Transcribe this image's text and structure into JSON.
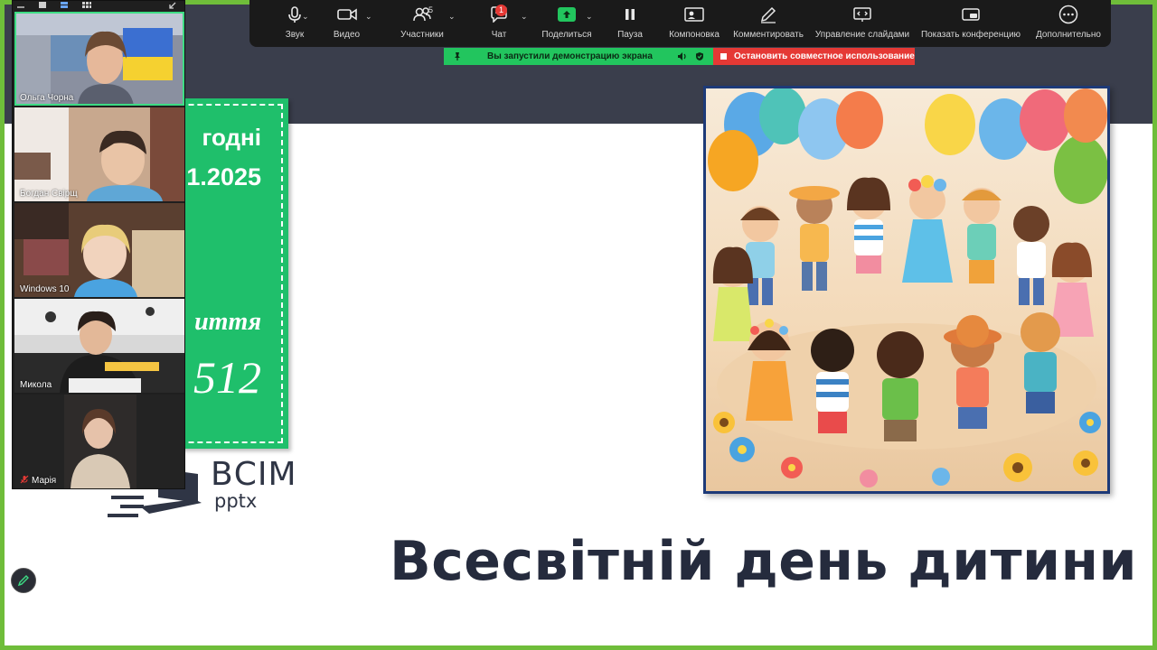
{
  "toolbar": {
    "items": [
      {
        "label": "Звук",
        "icon": "microphone-icon"
      },
      {
        "label": "Видео",
        "icon": "video-camera-icon"
      },
      {
        "label": "Участники",
        "icon": "participants-icon",
        "count": "5"
      },
      {
        "label": "Чат",
        "icon": "chat-icon",
        "badge": "1"
      },
      {
        "label": "Поделиться",
        "icon": "share-screen-icon"
      },
      {
        "label": "Пауза",
        "icon": "pause-icon"
      },
      {
        "label": "Компоновка",
        "icon": "layout-icon"
      },
      {
        "label": "Комментировать",
        "icon": "annotate-pen-icon"
      },
      {
        "label": "Управление слайдами",
        "icon": "slide-control-icon"
      },
      {
        "label": "Показать конференцию",
        "icon": "show-meeting-icon"
      },
      {
        "label": "Дополнительно",
        "icon": "more-icon"
      }
    ]
  },
  "share_notice": {
    "status": "Вы запустили демонстрацию экрана",
    "stop": "Остановить совместное использование"
  },
  "participants": [
    {
      "name": "Ольга Чорна",
      "active": true
    },
    {
      "name": "Богдан Свірщ",
      "active": false
    },
    {
      "name": "Windows 10",
      "active": false
    },
    {
      "name": "Микола",
      "active": false
    },
    {
      "name": "Марія",
      "active": false,
      "muted": true
    }
  ],
  "slide": {
    "card_line1": "годні",
    "card_line2": "1.2025",
    "card_line3": "иття",
    "card_line4": "512",
    "logo_title": "ВСІМ",
    "logo_sub": "pptx",
    "title": "Всесвітній день дитини"
  },
  "colors": {
    "share_border": "#6fbd3a",
    "card_green": "#1fbf6b",
    "notice_green": "#22c55e",
    "stop_red": "#e53935",
    "toolbar_bg": "#1a1a1a",
    "title_text": "#252b3d"
  }
}
